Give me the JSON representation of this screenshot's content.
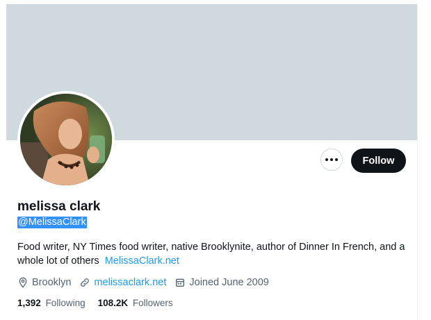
{
  "profile": {
    "display_name": "melissa clark",
    "handle": "@MelissaClark",
    "bio_text": "Food writer, NY Times food writer, native Brooklynite, author of Dinner In French, and a whole lot of others",
    "bio_link": "MelissaClark.net",
    "location": "Brooklyn",
    "website": "melissaclark.net",
    "joined": "Joined June 2009",
    "following_count": "1,392",
    "following_label": "Following",
    "followers_count": "108.2K",
    "followers_label": "Followers"
  },
  "actions": {
    "follow_label": "Follow"
  },
  "icons": {
    "more": "more-horizontal-icon",
    "location": "location-pin-icon",
    "website": "link-icon",
    "joined": "calendar-icon"
  },
  "colors": {
    "banner": "#cfd9de",
    "follow_bg": "#0f1419",
    "link": "#1d9bf0",
    "secondary_text": "#536471",
    "selection": "#3390ff"
  }
}
